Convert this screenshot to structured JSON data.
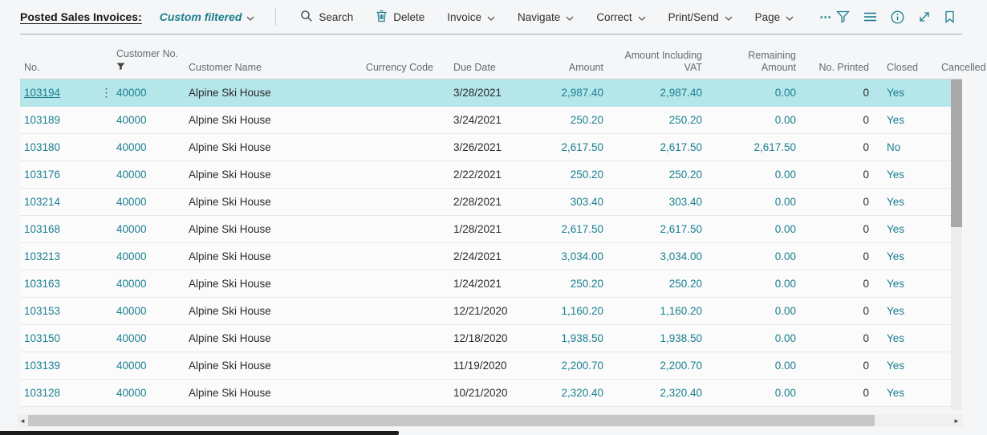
{
  "page": {
    "title": "Posted Sales Invoices:",
    "filter_label": "Custom filtered"
  },
  "toolbar": {
    "search": "Search",
    "delete": "Delete",
    "invoice": "Invoice",
    "navigate": "Navigate",
    "correct": "Correct",
    "print_send": "Print/Send",
    "page_menu": "Page",
    "more": "⋯"
  },
  "icons": {
    "search": "magnifier",
    "delete": "trash-can",
    "filter": "funnel",
    "show_list": "list-lines",
    "info": "info-circle",
    "expand": "diagonal-arrows",
    "bookmark": "bookmark",
    "row_ellipsis": "⋮",
    "scroll_left": "◄",
    "scroll_right": "►"
  },
  "colors": {
    "accent": "#1a7f8e",
    "selected_row": "#b5e6ea",
    "page_background": "#f5f6f7"
  },
  "table": {
    "columns": [
      {
        "id": "no",
        "label": "No."
      },
      {
        "id": "customer_no",
        "label": "Customer No.",
        "filtered": true
      },
      {
        "id": "customer_name",
        "label": "Customer Name"
      },
      {
        "id": "currency_code",
        "label": "Currency Code"
      },
      {
        "id": "due_date",
        "label": "Due Date"
      },
      {
        "id": "amount",
        "label": "Amount"
      },
      {
        "id": "amount_including_vat",
        "label": "Amount Including VAT"
      },
      {
        "id": "remaining_amount",
        "label": "Remaining Amount"
      },
      {
        "id": "no_printed",
        "label": "No. Printed"
      },
      {
        "id": "closed",
        "label": "Closed"
      },
      {
        "id": "cancelled",
        "label": "Cancelled"
      }
    ],
    "rows": [
      {
        "no": "103194",
        "customer_no": "40000",
        "customer_name": "Alpine Ski House",
        "currency_code": "",
        "due_date": "3/28/2021",
        "amount": "2,987.40",
        "amount_including_vat": "2,987.40",
        "remaining_amount": "0.00",
        "no_printed": "0",
        "closed": "Yes",
        "selected": true
      },
      {
        "no": "103189",
        "customer_no": "40000",
        "customer_name": "Alpine Ski House",
        "currency_code": "",
        "due_date": "3/24/2021",
        "amount": "250.20",
        "amount_including_vat": "250.20",
        "remaining_amount": "0.00",
        "no_printed": "0",
        "closed": "Yes",
        "selected": false
      },
      {
        "no": "103180",
        "customer_no": "40000",
        "customer_name": "Alpine Ski House",
        "currency_code": "",
        "due_date": "3/26/2021",
        "amount": "2,617.50",
        "amount_including_vat": "2,617.50",
        "remaining_amount": "2,617.50",
        "no_printed": "0",
        "closed": "No",
        "selected": false
      },
      {
        "no": "103176",
        "customer_no": "40000",
        "customer_name": "Alpine Ski House",
        "currency_code": "",
        "due_date": "2/22/2021",
        "amount": "250.20",
        "amount_including_vat": "250.20",
        "remaining_amount": "0.00",
        "no_printed": "0",
        "closed": "Yes",
        "selected": false
      },
      {
        "no": "103214",
        "customer_no": "40000",
        "customer_name": "Alpine Ski House",
        "currency_code": "",
        "due_date": "2/28/2021",
        "amount": "303.40",
        "amount_including_vat": "303.40",
        "remaining_amount": "0.00",
        "no_printed": "0",
        "closed": "Yes",
        "selected": false
      },
      {
        "no": "103168",
        "customer_no": "40000",
        "customer_name": "Alpine Ski House",
        "currency_code": "",
        "due_date": "1/28/2021",
        "amount": "2,617.50",
        "amount_including_vat": "2,617.50",
        "remaining_amount": "0.00",
        "no_printed": "0",
        "closed": "Yes",
        "selected": false
      },
      {
        "no": "103213",
        "customer_no": "40000",
        "customer_name": "Alpine Ski House",
        "currency_code": "",
        "due_date": "2/24/2021",
        "amount": "3,034.00",
        "amount_including_vat": "3,034.00",
        "remaining_amount": "0.00",
        "no_printed": "0",
        "closed": "Yes",
        "selected": false
      },
      {
        "no": "103163",
        "customer_no": "40000",
        "customer_name": "Alpine Ski House",
        "currency_code": "",
        "due_date": "1/24/2021",
        "amount": "250.20",
        "amount_including_vat": "250.20",
        "remaining_amount": "0.00",
        "no_printed": "0",
        "closed": "Yes",
        "selected": false
      },
      {
        "no": "103153",
        "customer_no": "40000",
        "customer_name": "Alpine Ski House",
        "currency_code": "",
        "due_date": "12/21/2020",
        "amount": "1,160.20",
        "amount_including_vat": "1,160.20",
        "remaining_amount": "0.00",
        "no_printed": "0",
        "closed": "Yes",
        "selected": false
      },
      {
        "no": "103150",
        "customer_no": "40000",
        "customer_name": "Alpine Ski House",
        "currency_code": "",
        "due_date": "12/18/2020",
        "amount": "1,938.50",
        "amount_including_vat": "1,938.50",
        "remaining_amount": "0.00",
        "no_printed": "0",
        "closed": "Yes",
        "selected": false
      },
      {
        "no": "103139",
        "customer_no": "40000",
        "customer_name": "Alpine Ski House",
        "currency_code": "",
        "due_date": "11/19/2020",
        "amount": "2,200.70",
        "amount_including_vat": "2,200.70",
        "remaining_amount": "0.00",
        "no_printed": "0",
        "closed": "Yes",
        "selected": false
      },
      {
        "no": "103128",
        "customer_no": "40000",
        "customer_name": "Alpine Ski House",
        "currency_code": "",
        "due_date": "10/21/2020",
        "amount": "2,320.40",
        "amount_including_vat": "2,320.40",
        "remaining_amount": "0.00",
        "no_printed": "0",
        "closed": "Yes",
        "selected": false
      }
    ]
  }
}
